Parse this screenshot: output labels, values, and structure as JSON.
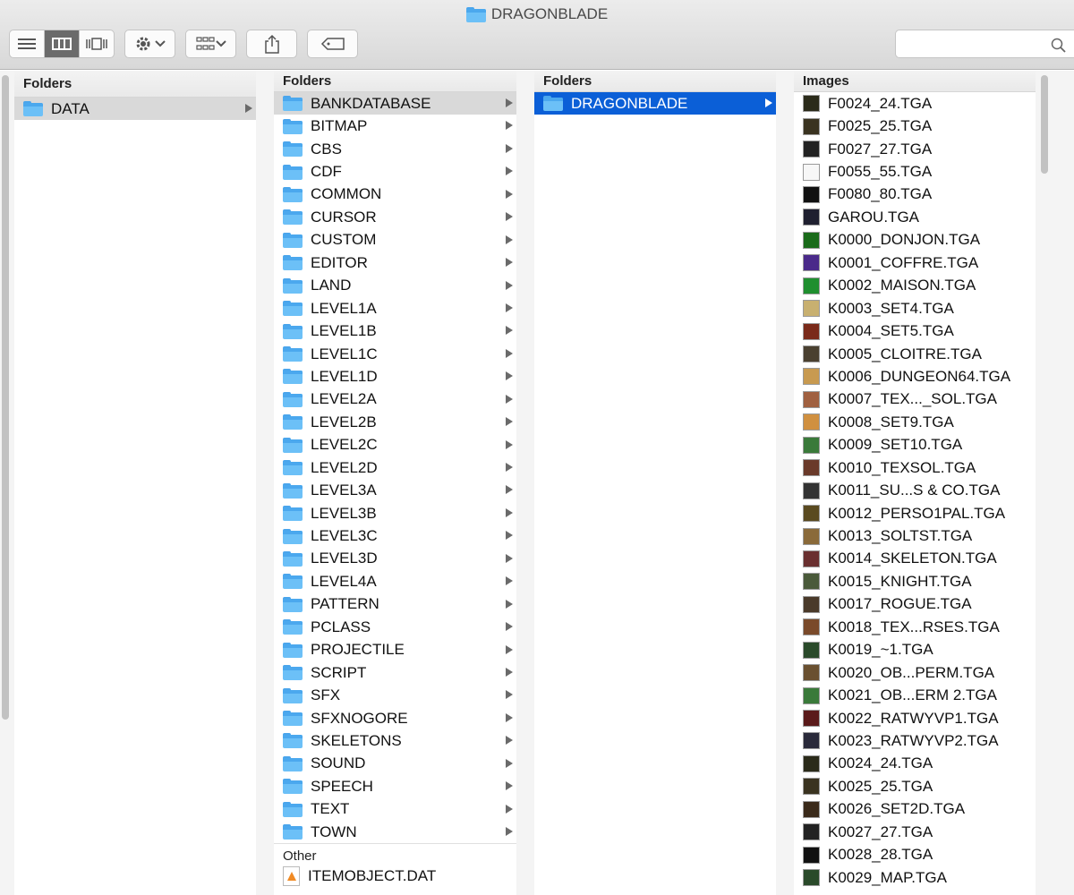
{
  "window": {
    "title": "DRAGONBLADE"
  },
  "toolbar": {
    "view_modes": [
      "list-view",
      "column-view",
      "coverflow-view"
    ],
    "active_view": "column-view",
    "search": {
      "value": "",
      "placeholder": ""
    }
  },
  "columns": [
    {
      "header": "Folders",
      "items": [
        {
          "label": "DATA",
          "icon": "folder-icon",
          "arrow": true,
          "selected": "gray"
        }
      ]
    },
    {
      "header": "Folders",
      "items": [
        {
          "label": "BANKDATABASE",
          "icon": "folder-icon",
          "arrow": true,
          "selected": "gray"
        },
        {
          "label": "BITMAP",
          "icon": "folder-icon",
          "arrow": true
        },
        {
          "label": "CBS",
          "icon": "folder-icon",
          "arrow": true
        },
        {
          "label": "CDF",
          "icon": "folder-icon",
          "arrow": true
        },
        {
          "label": "COMMON",
          "icon": "folder-icon",
          "arrow": true
        },
        {
          "label": "CURSOR",
          "icon": "folder-icon",
          "arrow": true
        },
        {
          "label": "CUSTOM",
          "icon": "folder-icon",
          "arrow": true
        },
        {
          "label": "EDITOR",
          "icon": "folder-icon",
          "arrow": true
        },
        {
          "label": "LAND",
          "icon": "folder-icon",
          "arrow": true
        },
        {
          "label": "LEVEL1A",
          "icon": "folder-icon",
          "arrow": true
        },
        {
          "label": "LEVEL1B",
          "icon": "folder-icon",
          "arrow": true
        },
        {
          "label": "LEVEL1C",
          "icon": "folder-icon",
          "arrow": true
        },
        {
          "label": "LEVEL1D",
          "icon": "folder-icon",
          "arrow": true
        },
        {
          "label": "LEVEL2A",
          "icon": "folder-icon",
          "arrow": true
        },
        {
          "label": "LEVEL2B",
          "icon": "folder-icon",
          "arrow": true
        },
        {
          "label": "LEVEL2C",
          "icon": "folder-icon",
          "arrow": true
        },
        {
          "label": "LEVEL2D",
          "icon": "folder-icon",
          "arrow": true
        },
        {
          "label": "LEVEL3A",
          "icon": "folder-icon",
          "arrow": true
        },
        {
          "label": "LEVEL3B",
          "icon": "folder-icon",
          "arrow": true
        },
        {
          "label": "LEVEL3C",
          "icon": "folder-icon",
          "arrow": true
        },
        {
          "label": "LEVEL3D",
          "icon": "folder-icon",
          "arrow": true
        },
        {
          "label": "LEVEL4A",
          "icon": "folder-icon",
          "arrow": true
        },
        {
          "label": "PATTERN",
          "icon": "folder-icon",
          "arrow": true
        },
        {
          "label": "PCLASS",
          "icon": "folder-icon",
          "arrow": true
        },
        {
          "label": "PROJECTILE",
          "icon": "folder-icon",
          "arrow": true
        },
        {
          "label": "SCRIPT",
          "icon": "folder-icon",
          "arrow": true
        },
        {
          "label": "SFX",
          "icon": "folder-icon",
          "arrow": true
        },
        {
          "label": "SFXNOGORE",
          "icon": "folder-icon",
          "arrow": true
        },
        {
          "label": "SKELETONS",
          "icon": "folder-icon",
          "arrow": true
        },
        {
          "label": "SOUND",
          "icon": "folder-icon",
          "arrow": true
        },
        {
          "label": "SPEECH",
          "icon": "folder-icon",
          "arrow": true
        },
        {
          "label": "TEXT",
          "icon": "folder-icon",
          "arrow": true
        },
        {
          "label": "TOWN",
          "icon": "folder-icon",
          "arrow": true
        }
      ],
      "other_section": {
        "header": "Other",
        "items": [
          {
            "label": "ITEMOBJECT.DAT",
            "icon": "dat-file-icon"
          }
        ]
      }
    },
    {
      "header": "Folders",
      "items": [
        {
          "label": "DRAGONBLADE",
          "icon": "folder-icon",
          "arrow": true,
          "selected": "blue"
        }
      ]
    },
    {
      "header": "Images",
      "items": [
        {
          "label": "F0024_24.TGA",
          "thumb": "#2b2b1a"
        },
        {
          "label": "F0025_25.TGA",
          "thumb": "#3a3320"
        },
        {
          "label": "F0027_27.TGA",
          "thumb": "#222"
        },
        {
          "label": "F0055_55.TGA",
          "thumb": "white"
        },
        {
          "label": "F0080_80.TGA",
          "thumb": "#111"
        },
        {
          "label": "GAROU.TGA",
          "thumb": "#1f2030"
        },
        {
          "label": "K0000_DONJON.TGA",
          "thumb": "#1a6b1a"
        },
        {
          "label": "K0001_COFFRE.TGA",
          "thumb": "#4a2a8a"
        },
        {
          "label": "K0002_MAISON.TGA",
          "thumb": "#1f8f2f"
        },
        {
          "label": "K0003_SET4.TGA",
          "thumb": "#c8b070"
        },
        {
          "label": "K0004_SET5.TGA",
          "thumb": "#7a2a1a"
        },
        {
          "label": "K0005_CLOITRE.TGA",
          "thumb": "#4a4030"
        },
        {
          "label": "K0006_DUNGEON64.TGA",
          "thumb": "#c89a50"
        },
        {
          "label": "K0007_TEX..._SOL.TGA",
          "thumb": "#a06040"
        },
        {
          "label": "K0008_SET9.TGA",
          "thumb": "#d09040"
        },
        {
          "label": "K0009_SET10.TGA",
          "thumb": "#3a7a3a"
        },
        {
          "label": "K0010_TEXSOL.TGA",
          "thumb": "#6a3a2a"
        },
        {
          "label": "K0011_SU...S & CO.TGA",
          "thumb": "#333"
        },
        {
          "label": "K0012_PERSO1PAL.TGA",
          "thumb": "#5a4a20"
        },
        {
          "label": "K0013_SOLTST.TGA",
          "thumb": "#8a6a3a"
        },
        {
          "label": "K0014_SKELETON.TGA",
          "thumb": "#6a3030"
        },
        {
          "label": "K0015_KNIGHT.TGA",
          "thumb": "#4a5a3a"
        },
        {
          "label": "K0017_ROGUE.TGA",
          "thumb": "#4a3a2a"
        },
        {
          "label": "K0018_TEX...RSES.TGA",
          "thumb": "#7a4a2a"
        },
        {
          "label": "K0019_~1.TGA",
          "thumb": "#2a4a2a"
        },
        {
          "label": "K0020_OB...PERM.TGA",
          "thumb": "#6a5030"
        },
        {
          "label": "K0021_OB...ERM 2.TGA",
          "thumb": "#3a7a3a"
        },
        {
          "label": "K0022_RATWYVP1.TGA",
          "thumb": "#5a1a1a"
        },
        {
          "label": "K0023_RATWYVP2.TGA",
          "thumb": "#2a2a3a"
        },
        {
          "label": "K0024_24.TGA",
          "thumb": "#2b2b1a"
        },
        {
          "label": "K0025_25.TGA",
          "thumb": "#3a3320"
        },
        {
          "label": "K0026_SET2D.TGA",
          "thumb": "#3a2a1a"
        },
        {
          "label": "K0027_27.TGA",
          "thumb": "#222"
        },
        {
          "label": "K0028_28.TGA",
          "thumb": "#111"
        },
        {
          "label": "K0029_MAP.TGA",
          "thumb": "#2a4a2a"
        }
      ]
    }
  ]
}
